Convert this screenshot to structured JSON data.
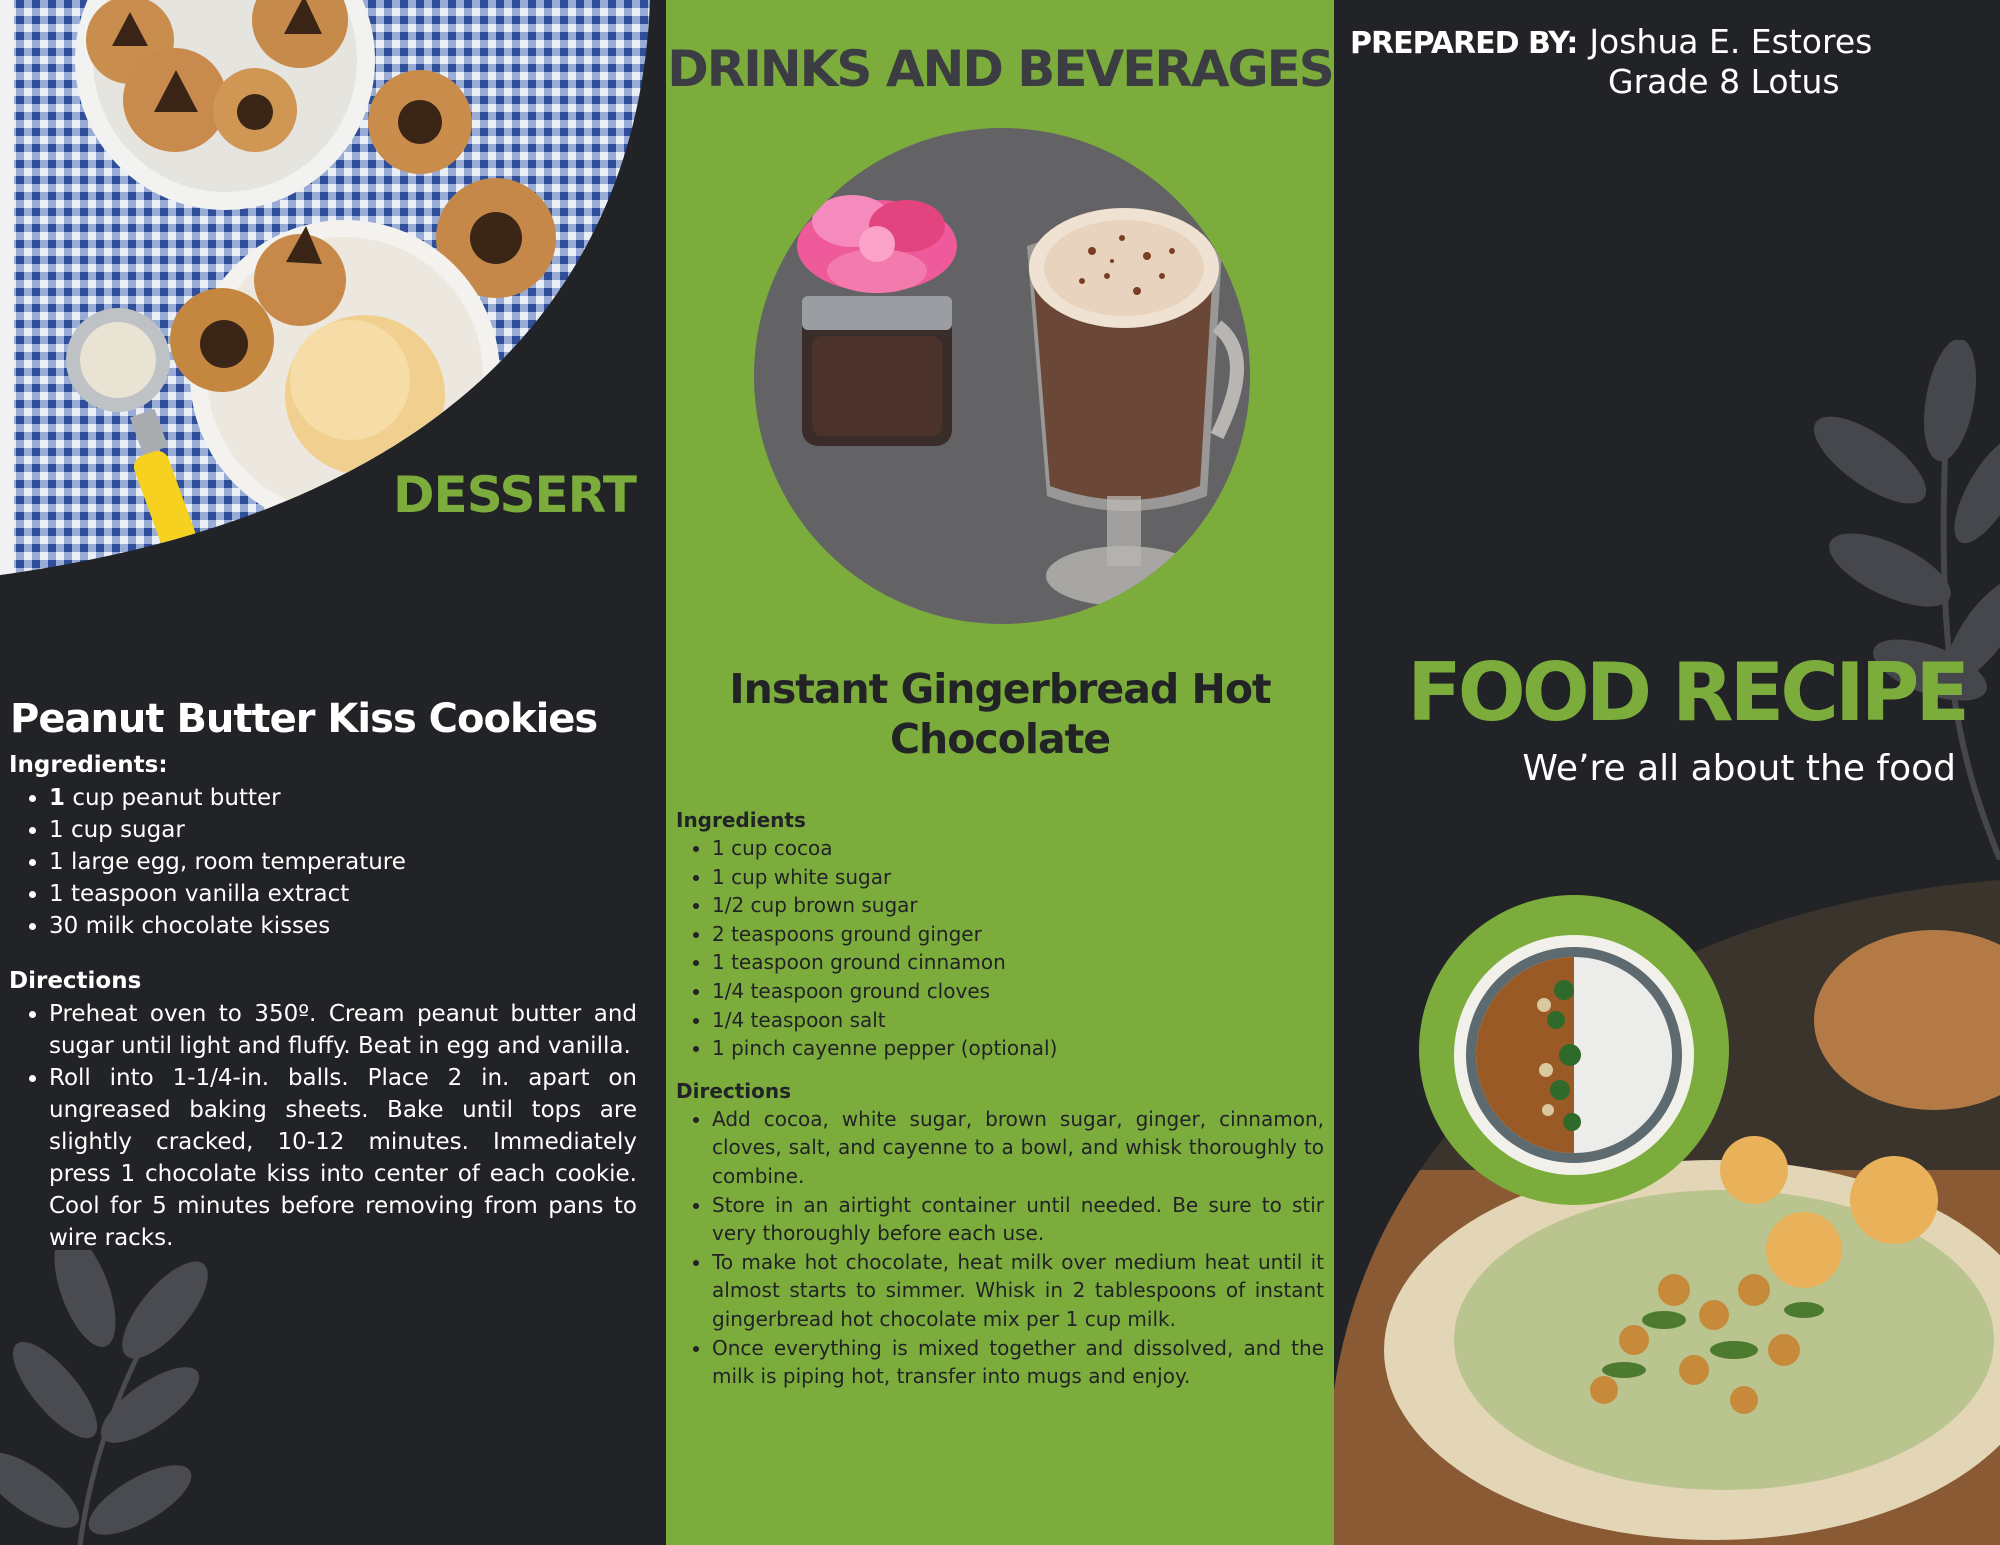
{
  "left_panel": {
    "section_title": "DESSERT",
    "recipe_title": "Peanut Butter Kiss Cookies",
    "ingredients_heading": "Ingredients:",
    "ingredients": [
      {
        "qty": "1",
        "text": " cup peanut butter"
      },
      {
        "qty": "",
        "text": "1 cup sugar"
      },
      {
        "qty": "",
        "text": "1 large egg, room temperature"
      },
      {
        "qty": "",
        "text": "1 teaspoon vanilla extract"
      },
      {
        "qty": "",
        "text": "30 milk chocolate kisses"
      }
    ],
    "directions_heading": "Directions",
    "directions": [
      "Preheat oven to 350º. Cream peanut butter and sugar until light and fluffy. Beat in egg and vanilla.",
      "Roll into 1-1/4-in. balls. Place 2 in. apart on ungreased baking sheets. Bake until tops are slightly cracked, 10-12 minutes. Immediately press 1 chocolate kiss into center of each cookie. Cool for 5 minutes before removing from pans to wire racks."
    ]
  },
  "middle_panel": {
    "section_title": "DRINKS AND BEVERAGES",
    "recipe_title_line1": "Instant Gingerbread Hot",
    "recipe_title_line2": "Chocolate",
    "ingredients_heading": "Ingredients",
    "ingredients": [
      "1 cup cocoa",
      "1 cup white sugar",
      "1/2 cup brown sugar",
      "2 teaspoons ground ginger",
      "1 teaspoon ground cinnamon",
      "1/4 teaspoon ground cloves",
      "1/4 teaspoon salt",
      "1 pinch cayenne pepper (optional)"
    ],
    "directions_heading": "Directions",
    "directions": [
      "Add cocoa, white sugar, brown sugar, ginger, cinnamon, cloves, salt, and cayenne to a bowl, and whisk thoroughly to combine.",
      "Store in an airtight container until needed. Be sure to stir very thoroughly before each use.",
      "To make hot chocolate, heat milk over medium heat until it almost starts to simmer. Whisk in 2 tablespoons of instant gingerbread hot chocolate mix per 1 cup milk.",
      "Once everything is mixed together and dissolved, and the milk is piping hot, transfer into mugs and enjoy."
    ]
  },
  "right_panel": {
    "prepared_label": "PREPARED BY:",
    "prepared_name": "Joshua E. Estores",
    "prepared_grade": "Grade 8 Lotus",
    "brand_title": "FOOD RECIPE",
    "tagline": "We’re all about the food"
  },
  "colors": {
    "accent_green": "#7cad3c",
    "dark_background": "#222326",
    "heading_gray": "#3b3d42"
  }
}
